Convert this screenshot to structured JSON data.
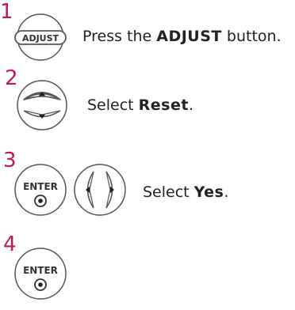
{
  "steps": [
    {
      "number": "1",
      "button_label": "ADJUST",
      "text_before": "Press the ",
      "text_bold": "ADJUST",
      "text_after": " button."
    },
    {
      "number": "2",
      "button_icon": "up-down-arrows-icon",
      "text_before": "Select ",
      "text_bold": "Reset",
      "text_after": "."
    },
    {
      "number": "3",
      "button_label": "ENTER",
      "button_icon_2": "left-right-arrows-icon",
      "text_before": "Select ",
      "text_bold": "Yes",
      "text_after": "."
    },
    {
      "number": "4",
      "button_label": "ENTER"
    }
  ],
  "colors": {
    "step_number": "#c2185b",
    "button_stroke": "#555555",
    "text": "#222222"
  }
}
